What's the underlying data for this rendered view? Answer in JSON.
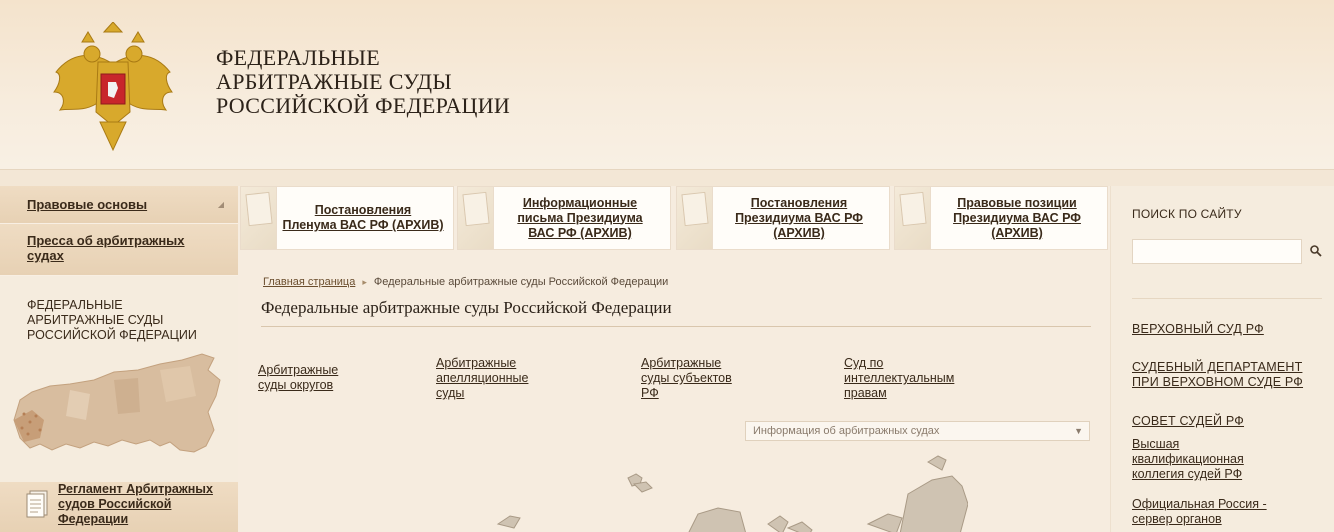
{
  "header": {
    "title_lines": [
      "ФЕДЕРАЛЬНЫЕ",
      "АРБИТРАЖНЫЕ СУДЫ",
      "РОССИЙСКОЙ ФЕДЕРАЦИИ"
    ]
  },
  "left_nav": {
    "items": [
      {
        "label": "Правовые основы"
      },
      {
        "label": "Пресса об арбитражных судах"
      }
    ],
    "federal_block_lines": [
      "ФЕДЕРАЛЬНЫЕ",
      "АРБИТРАЖНЫЕ СУДЫ",
      "РОССИЙСКОЙ ФЕДЕРАЦИИ"
    ],
    "reglament": "Регламент Арбитражных судов Российской Федерации"
  },
  "cards": [
    {
      "lines": [
        "Постановления",
        "Пленума ВАС РФ (АРХИВ)"
      ]
    },
    {
      "lines": [
        "Информационные",
        "письма Президиума",
        "ВАС РФ (АРХИВ)"
      ]
    },
    {
      "lines": [
        "Постановления",
        "Президиума ВАС РФ",
        "(АРХИВ)"
      ]
    },
    {
      "lines": [
        "Правовые позиции",
        "Президиума ВАС РФ",
        "(АРХИВ)"
      ]
    }
  ],
  "breadcrumb": {
    "home": "Главная страница",
    "current": "Федеральные арбитражные суды Российской Федерации"
  },
  "page_title": "Федеральные арбитражные суды Российской Федерации",
  "court_links": [
    {
      "lines": [
        "Арбитражные",
        "суды округов"
      ]
    },
    {
      "lines": [
        "Арбитражные",
        "апелляционные",
        "суды"
      ]
    },
    {
      "lines": [
        "Арбитражные",
        "суды субъектов",
        "РФ"
      ]
    },
    {
      "lines": [
        "Суд по",
        "интеллектуальным",
        "правам"
      ]
    }
  ],
  "info_select": {
    "placeholder": "Информация об арбитражных судах"
  },
  "right_sidebar": {
    "search_label": "ПОИСК ПО САЙТУ",
    "search_value": "",
    "links": [
      {
        "lines": [
          "ВЕРХОВНЫЙ СУД РФ"
        ]
      },
      {
        "lines": [
          "СУДЕБНЫЙ ДЕПАРТАМЕНТ",
          "ПРИ ВЕРХОВНОМ СУДЕ РФ"
        ]
      },
      {
        "lines": [
          "СОВЕТ СУДЕЙ РФ"
        ]
      },
      {
        "lines": [
          "Высшая",
          "квалификационная",
          "коллегия судей РФ"
        ]
      },
      {
        "lines": [
          "Официальная Россия -",
          "сервер органов"
        ]
      }
    ]
  },
  "colors": {
    "background": "#f3e7d6",
    "nav_band": "#e7d1b4",
    "text": "#3a2a1a",
    "map_fill": "#d9bea0"
  },
  "icons": [
    "double-headed-eagle-emblem-icon",
    "russia-map-icon",
    "document-icon",
    "search-icon",
    "chevron-down-icon"
  ]
}
